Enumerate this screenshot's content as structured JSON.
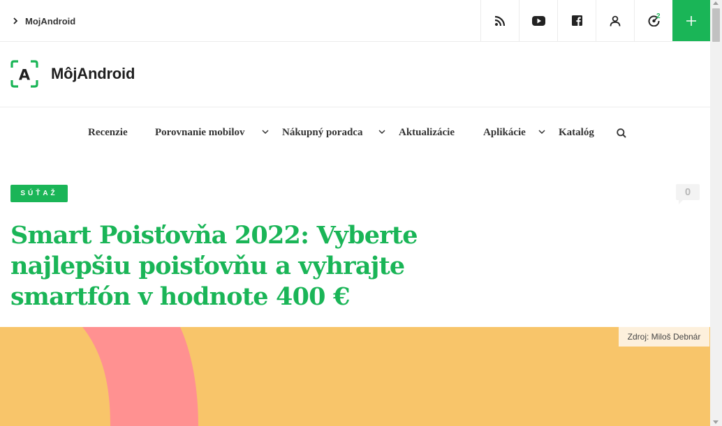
{
  "breadcrumb": {
    "label": "MojAndroid"
  },
  "topbar": {
    "icons": [
      "rss-icon",
      "youtube-icon",
      "facebook-icon",
      "user-icon",
      "bell-icon"
    ],
    "notification_count": "2",
    "plus_icon": "plus-icon"
  },
  "logo": {
    "mark": "A",
    "text": "MôjAndroid"
  },
  "nav": {
    "items": [
      {
        "label": "Recenzie",
        "dropdown": false
      },
      {
        "label": "Porovnanie mobilov",
        "dropdown": true
      },
      {
        "label": "Nákupný poradca",
        "dropdown": true
      },
      {
        "label": "Aktualizácie",
        "dropdown": false
      },
      {
        "label": "Aplikácie",
        "dropdown": true
      },
      {
        "label": "Katalóg",
        "dropdown": false
      }
    ]
  },
  "article": {
    "category": "SÚŤAŽ",
    "comment_count": "0",
    "title": "Smart Poisťovňa 2022: Vyberte najlepšiu poisťovňu a vyhrajte smartfón v hodnote 400 €",
    "image_source": "Zdroj: Miloš Debnár"
  },
  "colors": {
    "accent": "#1ab557",
    "hero_bg": "#f8c56a",
    "hero_shape": "#ff9191"
  }
}
